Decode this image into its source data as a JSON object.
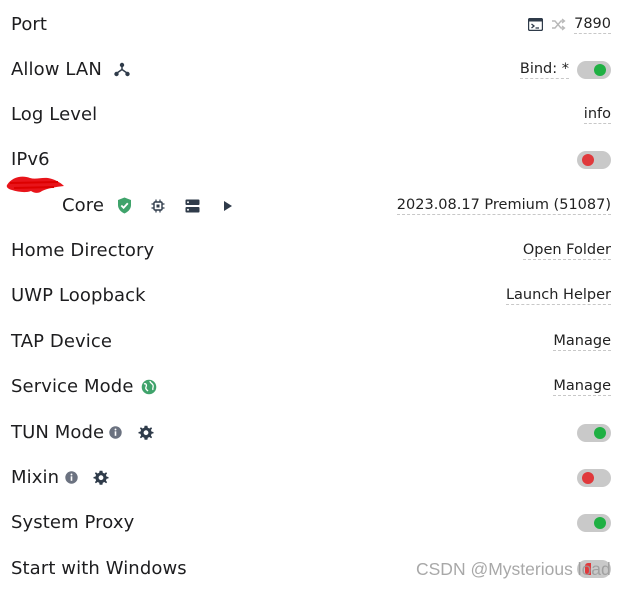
{
  "settings": {
    "port": {
      "label": "Port",
      "value": "7890"
    },
    "allow_lan": {
      "label": "Allow LAN",
      "bind_label": "Bind: *",
      "enabled": true
    },
    "log_level": {
      "label": "Log Level",
      "value": "info"
    },
    "ipv6": {
      "label": "IPv6",
      "enabled": false
    },
    "core": {
      "label": "Core",
      "version": "2023.08.17 Premium (51087)"
    },
    "home_directory": {
      "label": "Home Directory",
      "action": "Open Folder"
    },
    "uwp_loopback": {
      "label": "UWP Loopback",
      "action": "Launch Helper"
    },
    "tap_device": {
      "label": "TAP Device",
      "action": "Manage"
    },
    "service_mode": {
      "label": "Service Mode",
      "action": "Manage"
    },
    "tun_mode": {
      "label": "TUN Mode",
      "enabled": true
    },
    "mixin": {
      "label": "Mixin",
      "enabled": false
    },
    "system_proxy": {
      "label": "System Proxy",
      "enabled": true
    },
    "start_with_windows": {
      "label": "Start with Windows",
      "enabled": false
    }
  },
  "watermark": "CSDN @Mysterious  load",
  "colors": {
    "toggle_on": "#1fb043",
    "toggle_off": "#e0393c",
    "toggle_track": "#c9c9c9",
    "shield": "#3fa36b",
    "globe": "#3fa36b",
    "icon_dark": "#2f3b4a",
    "info_icon": "#6b7280"
  },
  "icons": [
    "terminal-icon",
    "shuffle-icon",
    "network-icon",
    "shield-check-icon",
    "chip-icon",
    "server-icon",
    "play-icon",
    "globe-icon",
    "info-icon",
    "gear-icon"
  ]
}
